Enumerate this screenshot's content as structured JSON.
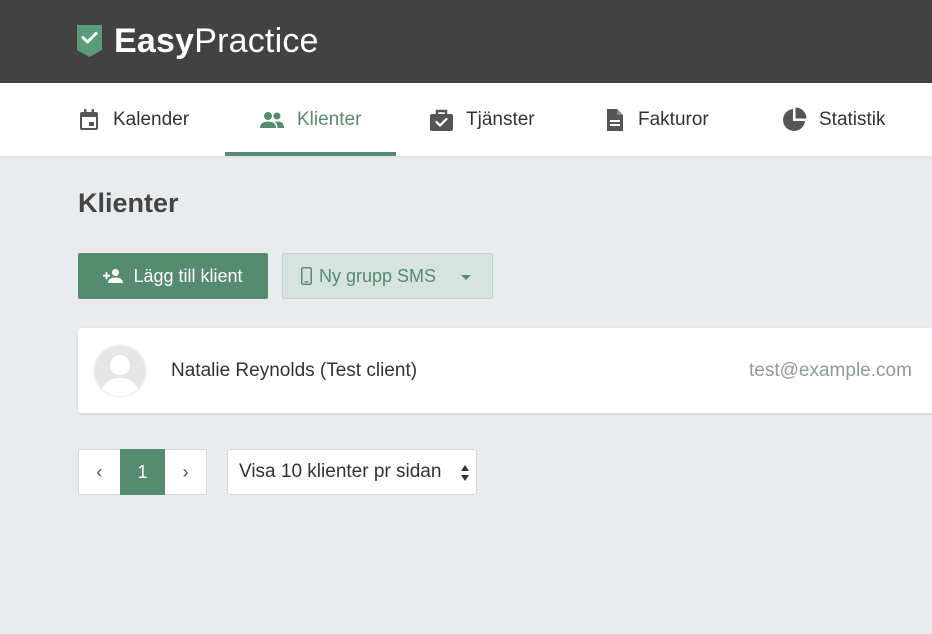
{
  "app": {
    "logo_bold": "Easy",
    "logo_light": "Practice",
    "brand_color": "#558b6e"
  },
  "nav": {
    "items": [
      {
        "label": "Kalender",
        "icon": "calendar-icon",
        "active": false
      },
      {
        "label": "Klienter",
        "icon": "people-icon",
        "active": true
      },
      {
        "label": "Tjänster",
        "icon": "briefcase-check-icon",
        "active": false
      },
      {
        "label": "Fakturor",
        "icon": "document-icon",
        "active": false
      },
      {
        "label": "Statistik",
        "icon": "pie-chart-icon",
        "active": false
      }
    ]
  },
  "page": {
    "title": "Klienter"
  },
  "actions": {
    "add_client_label": "Lägg till klient",
    "group_sms_label": "Ny grupp SMS"
  },
  "clients": [
    {
      "name": "Natalie Reynolds (Test client)",
      "email": "test@example.com"
    }
  ],
  "pagination": {
    "prev": "‹",
    "current": "1",
    "next": "›",
    "per_page_label": "Visa 10 klienter pr sidan"
  }
}
